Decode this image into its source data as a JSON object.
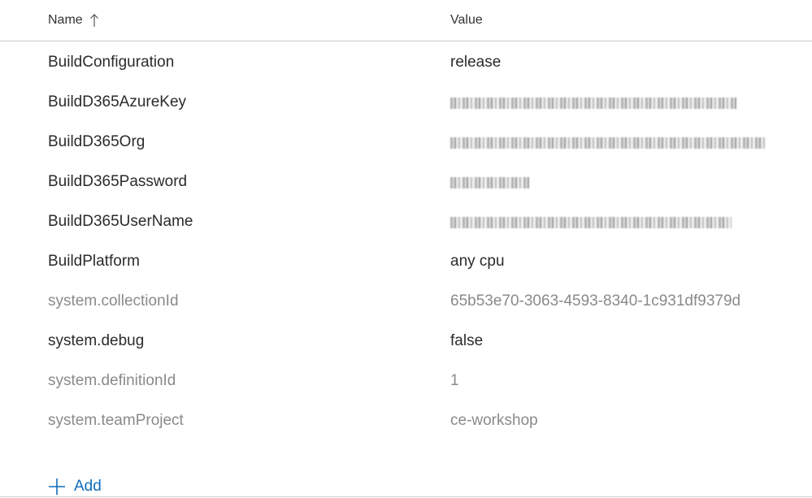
{
  "table": {
    "headers": {
      "name": "Name",
      "value": "Value"
    },
    "rows": [
      {
        "name": "BuildConfiguration",
        "value": "release",
        "secret": false,
        "kind": "user"
      },
      {
        "name": "BuildD365AzureKey",
        "value": "",
        "secret": true,
        "kind": "user",
        "mask_width": 352
      },
      {
        "name": "BuildD365Org",
        "value": "",
        "secret": true,
        "kind": "user",
        "mask_width": 387
      },
      {
        "name": "BuildD365Password",
        "value": "",
        "secret": true,
        "kind": "user",
        "mask_width": 97
      },
      {
        "name": "BuildD365UserName",
        "value": "",
        "secret": true,
        "kind": "user",
        "mask_width": 346
      },
      {
        "name": "BuildPlatform",
        "value": "any cpu",
        "secret": false,
        "kind": "user"
      },
      {
        "name": "system.collectionId",
        "value": "65b53e70-3063-4593-8340-1c931df9379d",
        "secret": false,
        "kind": "system"
      },
      {
        "name": "system.debug",
        "value": "false",
        "secret": false,
        "kind": "user"
      },
      {
        "name": "system.definitionId",
        "value": "1",
        "secret": false,
        "kind": "system"
      },
      {
        "name": "system.teamProject",
        "value": "ce-workshop",
        "secret": false,
        "kind": "system"
      }
    ]
  },
  "actions": {
    "add_label": "Add"
  },
  "icons": {
    "sort": "arrow-up-icon",
    "add": "plus-icon"
  },
  "colors": {
    "accent": "#0f6cbd",
    "text": "#2b2b2b",
    "muted": "#8a8a8a",
    "divider": "#c8c8c8"
  }
}
